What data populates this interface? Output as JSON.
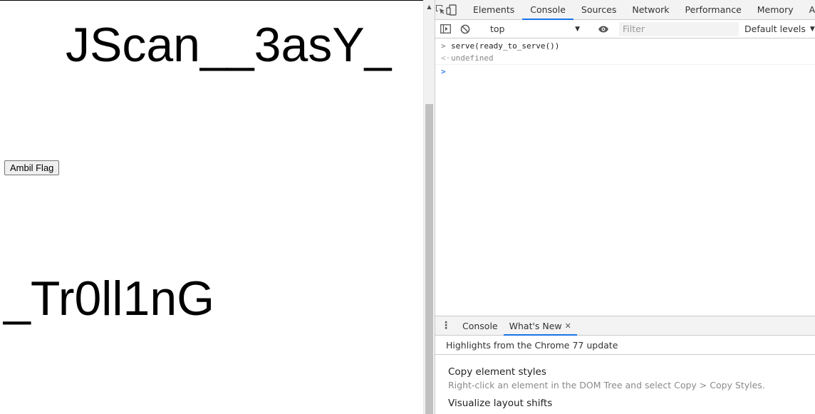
{
  "page": {
    "headline_top": "JScan__3asY_",
    "button_label": "Ambil Flag",
    "headline_bottom": "_Tr0ll1nG"
  },
  "devtools": {
    "tabs": [
      "Elements",
      "Console",
      "Sources",
      "Network",
      "Performance",
      "Memory",
      "Ap"
    ],
    "active_tab": "Console",
    "toolbar": {
      "context": "top",
      "filter_placeholder": "Filter",
      "levels": "Default levels"
    },
    "console": {
      "input_command": "serve(ready_to_serve())",
      "result": "undefined"
    },
    "drawer": {
      "tabs": [
        "Console",
        "What's New"
      ],
      "active_tab": "What's New",
      "highlights": "Highlights from the Chrome 77 update",
      "features": [
        {
          "title": "Copy element styles",
          "desc": "Right-click an element in the DOM Tree and select Copy > Copy Styles."
        },
        {
          "title": "Visualize layout shifts",
          "desc": ""
        }
      ]
    }
  },
  "colors": {
    "accent": "#1a73e8",
    "prompt": "#367cf1"
  }
}
